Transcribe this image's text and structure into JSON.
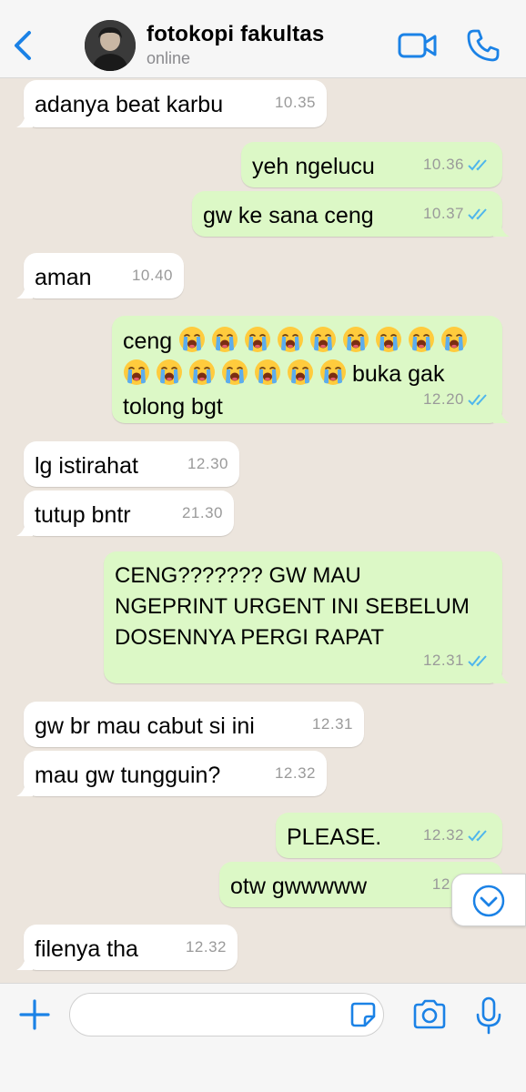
{
  "header": {
    "contact_name": "fotokopi fakultas",
    "status": "online"
  },
  "messages": [
    {
      "dir": "in",
      "text": "adanya beat karbu",
      "time": "10.35"
    },
    {
      "dir": "out",
      "text": "yeh ngelucu",
      "time": "10.36",
      "read": true
    },
    {
      "dir": "out",
      "text": "gw ke sana ceng",
      "time": "10.37",
      "read": true
    },
    {
      "dir": "in",
      "text": "aman",
      "time": "10.40"
    },
    {
      "dir": "out",
      "text_prefix": "ceng",
      "emoji_count": 16,
      "text_suffix": "buka gak",
      "text_line3": "tolong bgt",
      "emoji_name": "loudly-crying-face-emoji",
      "time": "12.20",
      "read": true
    },
    {
      "dir": "in",
      "text": "lg istirahat",
      "time": "12.30"
    },
    {
      "dir": "in",
      "text": "tutup bntr",
      "time": "21.30"
    },
    {
      "dir": "out",
      "text": "CENG??????? GW MAU\nNGEPRINT URGENT INI SEBELUM\nDOSENNYA PERGI RAPAT",
      "time": "12.31",
      "read": true
    },
    {
      "dir": "in",
      "text": "gw br mau cabut si ini",
      "time": "12.31"
    },
    {
      "dir": "in",
      "text": "mau gw tungguin?",
      "time": "12.32"
    },
    {
      "dir": "out",
      "text": "PLEASE.",
      "time": "12.32",
      "read": true
    },
    {
      "dir": "out",
      "text": "otw gwwwww",
      "time": "12.3",
      "read": true
    },
    {
      "dir": "in",
      "text": "filenya tha",
      "time": "12.32"
    }
  ],
  "composer": {
    "placeholder": ""
  },
  "colors": {
    "background": "#ECE5DD",
    "outgoing_bubble": "#DCF8C6",
    "incoming_bubble": "#FFFFFF",
    "accent_blue": "#1B82E6",
    "read_ticks": "#4FB6EC",
    "timestamp": "#9A9A9A"
  },
  "icons": [
    "back-chevron-icon",
    "video-call-icon",
    "phone-call-icon",
    "double-check-icon",
    "chevron-down-circle-icon",
    "plus-icon",
    "sticker-icon",
    "camera-icon",
    "microphone-icon"
  ]
}
